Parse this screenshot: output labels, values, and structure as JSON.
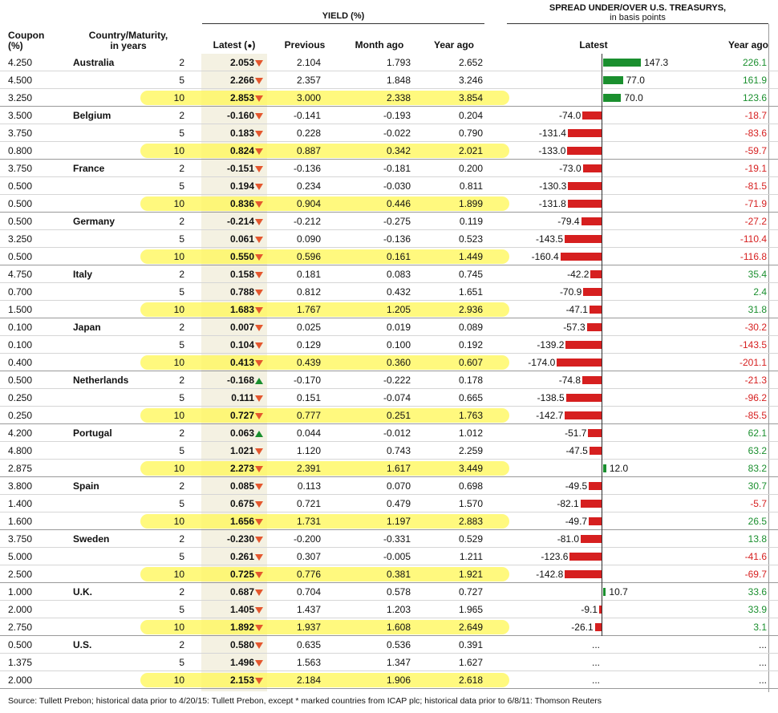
{
  "header": {
    "yield_title": "YIELD (%)",
    "spread_title_1": "SPREAD UNDER/OVER U.S. TREASURYS,",
    "spread_title_2": "in basis points",
    "coupon_1": "Coupon",
    "coupon_2": "(%)",
    "country_1": "Country/Maturity,",
    "country_2": "in years",
    "latest": "Latest (",
    "latest_mark": "●",
    "latest_close": ")",
    "previous": "Previous",
    "month_ago": "Month ago",
    "year_ago": "Year ago",
    "spread_latest": "Latest",
    "spread_year_ago": "Year ago"
  },
  "colors": {
    "positive": "#1a8f2e",
    "negative": "#d61f1f",
    "down_arrow": "#e4572e",
    "highlight": "#fff75a"
  },
  "chart_data": {
    "type": "table",
    "title": "",
    "columns": [
      "Coupon (%)",
      "Country",
      "Maturity",
      "Latest",
      "Previous",
      "Month ago",
      "Year ago",
      "Spread Latest",
      "Spread Year ago"
    ],
    "rows": [
      {
        "coupon": "4.250",
        "country": "Australia",
        "maturity": "2",
        "latest": "2.053",
        "dir": "down",
        "previous": "2.104",
        "month_ago": "1.793",
        "year_ago": "2.652",
        "spread": 147.3,
        "spread_label": "147.3",
        "spread_year": "226.1",
        "hl": false
      },
      {
        "coupon": "4.500",
        "country": "",
        "maturity": "5",
        "latest": "2.266",
        "dir": "down",
        "previous": "2.357",
        "month_ago": "1.848",
        "year_ago": "3.246",
        "spread": 77.0,
        "spread_label": "77.0",
        "spread_year": "161.9",
        "hl": false
      },
      {
        "coupon": "3.250",
        "country": "",
        "maturity": "10",
        "latest": "2.853",
        "dir": "down",
        "previous": "3.000",
        "month_ago": "2.338",
        "year_ago": "3.854",
        "spread": 70.0,
        "spread_label": "70.0",
        "spread_year": "123.6",
        "hl": true
      },
      {
        "coupon": "3.500",
        "country": "Belgium",
        "maturity": "2",
        "latest": "-0.160",
        "dir": "down",
        "previous": "-0.141",
        "month_ago": "-0.193",
        "year_ago": "0.204",
        "spread": -74.0,
        "spread_label": "-74.0",
        "spread_year": "-18.7",
        "hl": false
      },
      {
        "coupon": "3.750",
        "country": "",
        "maturity": "5",
        "latest": "0.183",
        "dir": "down",
        "previous": "0.228",
        "month_ago": "-0.022",
        "year_ago": "0.790",
        "spread": -131.4,
        "spread_label": "-131.4",
        "spread_year": "-83.6",
        "hl": false
      },
      {
        "coupon": "0.800",
        "country": "",
        "maturity": "10",
        "latest": "0.824",
        "dir": "down",
        "previous": "0.887",
        "month_ago": "0.342",
        "year_ago": "2.021",
        "spread": -133.0,
        "spread_label": "-133.0",
        "spread_year": "-59.7",
        "hl": true
      },
      {
        "coupon": "3.750",
        "country": "France",
        "maturity": "2",
        "latest": "-0.151",
        "dir": "down",
        "previous": "-0.136",
        "month_ago": "-0.181",
        "year_ago": "0.200",
        "spread": -73.0,
        "spread_label": "-73.0",
        "spread_year": "-19.1",
        "hl": false
      },
      {
        "coupon": "0.500",
        "country": "",
        "maturity": "5",
        "latest": "0.194",
        "dir": "down",
        "previous": "0.234",
        "month_ago": "-0.030",
        "year_ago": "0.811",
        "spread": -130.3,
        "spread_label": "-130.3",
        "spread_year": "-81.5",
        "hl": false
      },
      {
        "coupon": "0.500",
        "country": "",
        "maturity": "10",
        "latest": "0.836",
        "dir": "down",
        "previous": "0.904",
        "month_ago": "0.446",
        "year_ago": "1.899",
        "spread": -131.8,
        "spread_label": "-131.8",
        "spread_year": "-71.9",
        "hl": true
      },
      {
        "coupon": "0.500",
        "country": "Germany",
        "maturity": "2",
        "latest": "-0.214",
        "dir": "down",
        "previous": "-0.212",
        "month_ago": "-0.275",
        "year_ago": "0.119",
        "spread": -79.4,
        "spread_label": "-79.4",
        "spread_year": "-27.2",
        "hl": false
      },
      {
        "coupon": "3.250",
        "country": "",
        "maturity": "5",
        "latest": "0.061",
        "dir": "down",
        "previous": "0.090",
        "month_ago": "-0.136",
        "year_ago": "0.523",
        "spread": -143.5,
        "spread_label": "-143.5",
        "spread_year": "-110.4",
        "hl": false
      },
      {
        "coupon": "0.500",
        "country": "",
        "maturity": "10",
        "latest": "0.550",
        "dir": "down",
        "previous": "0.596",
        "month_ago": "0.161",
        "year_ago": "1.449",
        "spread": -160.4,
        "spread_label": "-160.4",
        "spread_year": "-116.8",
        "hl": true
      },
      {
        "coupon": "4.750",
        "country": "Italy",
        "maturity": "2",
        "latest": "0.158",
        "dir": "down",
        "previous": "0.181",
        "month_ago": "0.083",
        "year_ago": "0.745",
        "spread": -42.2,
        "spread_label": "-42.2",
        "spread_year": "35.4",
        "hl": false
      },
      {
        "coupon": "0.700",
        "country": "",
        "maturity": "5",
        "latest": "0.788",
        "dir": "down",
        "previous": "0.812",
        "month_ago": "0.432",
        "year_ago": "1.651",
        "spread": -70.9,
        "spread_label": "-70.9",
        "spread_year": "2.4",
        "hl": false
      },
      {
        "coupon": "1.500",
        "country": "",
        "maturity": "10",
        "latest": "1.683",
        "dir": "down",
        "previous": "1.767",
        "month_ago": "1.205",
        "year_ago": "2.936",
        "spread": -47.1,
        "spread_label": "-47.1",
        "spread_year": "31.8",
        "hl": true
      },
      {
        "coupon": "0.100",
        "country": "Japan",
        "maturity": "2",
        "latest": "0.007",
        "dir": "down",
        "previous": "0.025",
        "month_ago": "0.019",
        "year_ago": "0.089",
        "spread": -57.3,
        "spread_label": "-57.3",
        "spread_year": "-30.2",
        "hl": false
      },
      {
        "coupon": "0.100",
        "country": "",
        "maturity": "5",
        "latest": "0.104",
        "dir": "down",
        "previous": "0.129",
        "month_ago": "0.100",
        "year_ago": "0.192",
        "spread": -139.2,
        "spread_label": "-139.2",
        "spread_year": "-143.5",
        "hl": false
      },
      {
        "coupon": "0.400",
        "country": "",
        "maturity": "10",
        "latest": "0.413",
        "dir": "down",
        "previous": "0.439",
        "month_ago": "0.360",
        "year_ago": "0.607",
        "spread": -174.0,
        "spread_label": "-174.0",
        "spread_year": "-201.1",
        "hl": true
      },
      {
        "coupon": "0.500",
        "country": "Netherlands",
        "maturity": "2",
        "latest": "-0.168",
        "dir": "up",
        "previous": "-0.170",
        "month_ago": "-0.222",
        "year_ago": "0.178",
        "spread": -74.8,
        "spread_label": "-74.8",
        "spread_year": "-21.3",
        "hl": false
      },
      {
        "coupon": "0.250",
        "country": "",
        "maturity": "5",
        "latest": "0.111",
        "dir": "down",
        "previous": "0.151",
        "month_ago": "-0.074",
        "year_ago": "0.665",
        "spread": -138.5,
        "spread_label": "-138.5",
        "spread_year": "-96.2",
        "hl": false
      },
      {
        "coupon": "0.250",
        "country": "",
        "maturity": "10",
        "latest": "0.727",
        "dir": "down",
        "previous": "0.777",
        "month_ago": "0.251",
        "year_ago": "1.763",
        "spread": -142.7,
        "spread_label": "-142.7",
        "spread_year": "-85.5",
        "hl": true
      },
      {
        "coupon": "4.200",
        "country": "Portugal",
        "maturity": "2",
        "latest": "0.063",
        "dir": "up",
        "previous": "0.044",
        "month_ago": "-0.012",
        "year_ago": "1.012",
        "spread": -51.7,
        "spread_label": "-51.7",
        "spread_year": "62.1",
        "hl": false
      },
      {
        "coupon": "4.800",
        "country": "",
        "maturity": "5",
        "latest": "1.021",
        "dir": "down",
        "previous": "1.120",
        "month_ago": "0.743",
        "year_ago": "2.259",
        "spread": -47.5,
        "spread_label": "-47.5",
        "spread_year": "63.2",
        "hl": false
      },
      {
        "coupon": "2.875",
        "country": "",
        "maturity": "10",
        "latest": "2.273",
        "dir": "down",
        "previous": "2.391",
        "month_ago": "1.617",
        "year_ago": "3.449",
        "spread": 12.0,
        "spread_label": "12.0",
        "spread_year": "83.2",
        "hl": true
      },
      {
        "coupon": "3.800",
        "country": "Spain",
        "maturity": "2",
        "latest": "0.085",
        "dir": "down",
        "previous": "0.113",
        "month_ago": "0.070",
        "year_ago": "0.698",
        "spread": -49.5,
        "spread_label": "-49.5",
        "spread_year": "30.7",
        "hl": false
      },
      {
        "coupon": "1.400",
        "country": "",
        "maturity": "5",
        "latest": "0.675",
        "dir": "down",
        "previous": "0.721",
        "month_ago": "0.479",
        "year_ago": "1.570",
        "spread": -82.1,
        "spread_label": "-82.1",
        "spread_year": "-5.7",
        "hl": false
      },
      {
        "coupon": "1.600",
        "country": "",
        "maturity": "10",
        "latest": "1.656",
        "dir": "down",
        "previous": "1.731",
        "month_ago": "1.197",
        "year_ago": "2.883",
        "spread": -49.7,
        "spread_label": "-49.7",
        "spread_year": "26.5",
        "hl": true
      },
      {
        "coupon": "3.750",
        "country": "Sweden",
        "maturity": "2",
        "latest": "-0.230",
        "dir": "down",
        "previous": "-0.200",
        "month_ago": "-0.331",
        "year_ago": "0.529",
        "spread": -81.0,
        "spread_label": "-81.0",
        "spread_year": "13.8",
        "hl": false
      },
      {
        "coupon": "5.000",
        "country": "",
        "maturity": "5",
        "latest": "0.261",
        "dir": "down",
        "previous": "0.307",
        "month_ago": "-0.005",
        "year_ago": "1.211",
        "spread": -123.6,
        "spread_label": "-123.6",
        "spread_year": "-41.6",
        "hl": false
      },
      {
        "coupon": "2.500",
        "country": "",
        "maturity": "10",
        "latest": "0.725",
        "dir": "down",
        "previous": "0.776",
        "month_ago": "0.381",
        "year_ago": "1.921",
        "spread": -142.8,
        "spread_label": "-142.8",
        "spread_year": "-69.7",
        "hl": true
      },
      {
        "coupon": "1.000",
        "country": "U.K.",
        "maturity": "2",
        "latest": "0.687",
        "dir": "down",
        "previous": "0.704",
        "month_ago": "0.578",
        "year_ago": "0.727",
        "spread": 10.7,
        "spread_label": "10.7",
        "spread_year": "33.6",
        "hl": false
      },
      {
        "coupon": "2.000",
        "country": "",
        "maturity": "5",
        "latest": "1.405",
        "dir": "down",
        "previous": "1.437",
        "month_ago": "1.203",
        "year_ago": "1.965",
        "spread": -9.1,
        "spread_label": "-9.1",
        "spread_year": "33.9",
        "hl": false
      },
      {
        "coupon": "2.750",
        "country": "",
        "maturity": "10",
        "latest": "1.892",
        "dir": "down",
        "previous": "1.937",
        "month_ago": "1.608",
        "year_ago": "2.649",
        "spread": -26.1,
        "spread_label": "-26.1",
        "spread_year": "3.1",
        "hl": true
      },
      {
        "coupon": "0.500",
        "country": "U.S.",
        "maturity": "2",
        "latest": "0.580",
        "dir": "down",
        "previous": "0.635",
        "month_ago": "0.536",
        "year_ago": "0.391",
        "spread": null,
        "spread_label": "...",
        "spread_year": "...",
        "hl": false
      },
      {
        "coupon": "1.375",
        "country": "",
        "maturity": "5",
        "latest": "1.496",
        "dir": "down",
        "previous": "1.563",
        "month_ago": "1.347",
        "year_ago": "1.627",
        "spread": null,
        "spread_label": "...",
        "spread_year": "...",
        "hl": false
      },
      {
        "coupon": "2.000",
        "country": "",
        "maturity": "10",
        "latest": "2.153",
        "dir": "down",
        "previous": "2.184",
        "month_ago": "1.906",
        "year_ago": "2.618",
        "spread": null,
        "spread_label": "...",
        "spread_year": "...",
        "hl": true
      }
    ]
  },
  "source": "Source: Tullett Prebon; historical data prior to 4/20/15: Tullett Prebon, except * marked countries from ICAP plc; historical data prior to 6/8/11: Thomson Reuters"
}
